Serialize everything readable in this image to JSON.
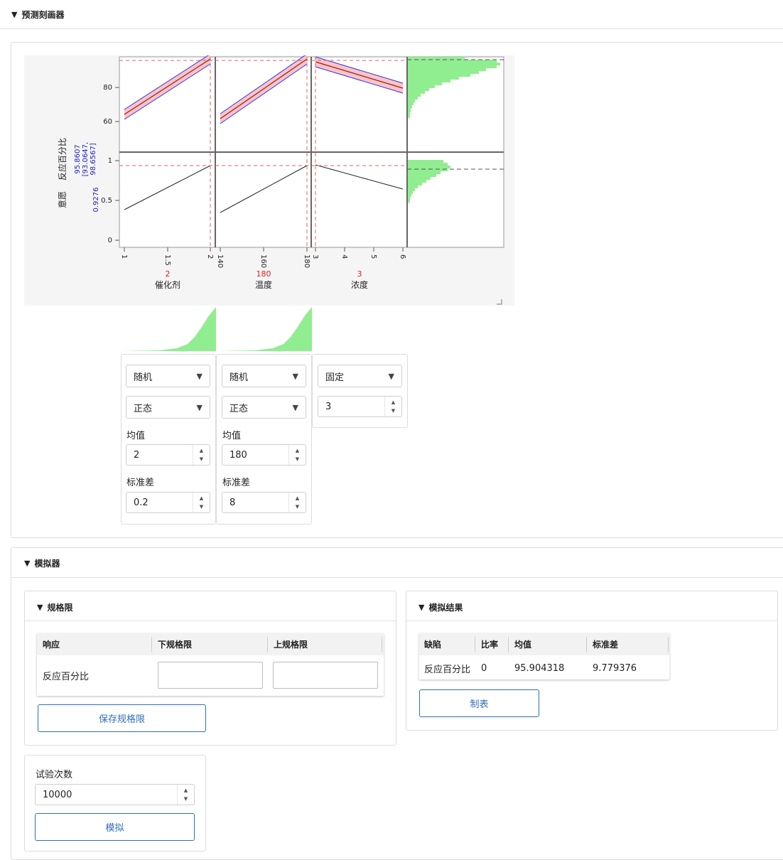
{
  "profiler": {
    "title": "预测刻画器",
    "responses": [
      {
        "label": "反应百分比",
        "value": "95.8607",
        "ci": "[93.0647,",
        "ci2": "98.6567]"
      },
      {
        "label": "意愿",
        "value": "0.9276"
      }
    ],
    "factors": [
      {
        "name": "催化剂",
        "current": "2",
        "ticks": [
          "1",
          "1.5",
          "2"
        ]
      },
      {
        "name": "温度",
        "current": "180",
        "ticks": [
          "140",
          "160",
          "180"
        ]
      },
      {
        "name": "浓度",
        "current": "3",
        "ticks": [
          "3",
          "4",
          "5",
          "6"
        ]
      }
    ],
    "y_ticks_top": [
      "60",
      "80"
    ],
    "y_ticks_bottom": [
      "0",
      "0.5",
      "1"
    ],
    "colors": {
      "current": "#e02020",
      "ci": "#3030ff",
      "band": "#f7c6c6",
      "hist": "#90ee90",
      "panel_bg": "#f5f5f5"
    }
  },
  "factor_settings": [
    {
      "mode": "随机",
      "dist": "正态",
      "mean_label": "均值",
      "mean": "2",
      "sd_label": "标准差",
      "sd": "0.2"
    },
    {
      "mode": "随机",
      "dist": "正态",
      "mean_label": "均值",
      "mean": "180",
      "sd_label": "标准差",
      "sd": "8"
    },
    {
      "mode": "固定",
      "value": "3"
    }
  ],
  "simulator": {
    "title": "模拟器",
    "spec_limits": {
      "title": "规格限",
      "headers": [
        "响应",
        "下规格限",
        "上规格限"
      ],
      "row_label": "反应百分比",
      "save_button": "保存规格限"
    },
    "results": {
      "title": "模拟结果",
      "headers": [
        "缺陷",
        "比率",
        "均值",
        "标准差"
      ],
      "row": [
        "反应百分比",
        "0",
        "95.904318",
        "9.779376"
      ],
      "table_button": "制表"
    },
    "runs": {
      "label": "试验次数",
      "value": "10000",
      "simulate_button": "模拟"
    }
  }
}
